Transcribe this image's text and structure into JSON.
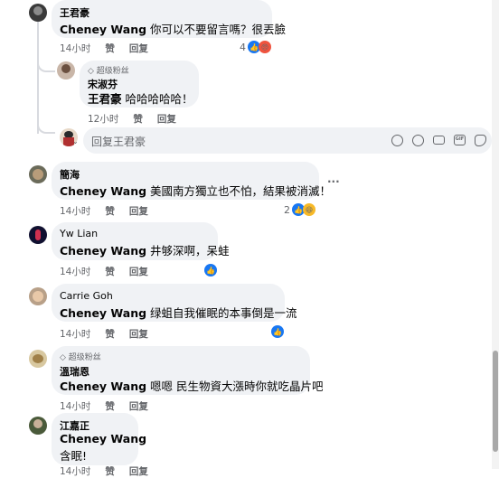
{
  "top_comment": {
    "author": "王君豪",
    "mention": "Cheney Wang",
    "text": "你可以不要留言嗎？很丟臉",
    "time": "14小时",
    "like": "赞",
    "reply": "回复",
    "reaction_count": "4"
  },
  "reply": {
    "badge": "超级粉丝",
    "author": "宋淑芬",
    "mention": "王君豪",
    "text": "哈哈哈哈哈！",
    "time": "12小时",
    "like": "赞",
    "reply": "回复"
  },
  "reply_box": {
    "placeholder": "回复王君豪"
  },
  "comments": [
    {
      "author": "簡海",
      "mention": "Cheney Wang",
      "text": "美國南方獨立也不怕，結果被消滅！",
      "time": "14小时",
      "like": "赞",
      "reply": "回复",
      "reaction_count": "2",
      "more": "···"
    },
    {
      "author": "Yw Lian",
      "mention": "Cheney Wang",
      "text": "井够深啊，呆蛙",
      "time": "14小时",
      "like": "赞",
      "reply": "回复"
    },
    {
      "author": "Carrie Goh",
      "mention": "Cheney Wang",
      "text": "绿蛆自我催眠的本事倒是一流",
      "time": "14小时",
      "like": "赞",
      "reply": "回复"
    },
    {
      "badge": "超级粉丝",
      "author": "溫瑞恩",
      "mention": "Cheney Wang",
      "text": "嗯嗯 民生物資大漲時你就吃晶片吧",
      "time": "14小时",
      "like": "赞",
      "reply": "回复"
    },
    {
      "author": "江嘉正",
      "mention": "Cheney Wang",
      "text": "含眠!",
      "time": "14小时",
      "like": "赞",
      "reply": "回复"
    }
  ],
  "colors": {
    "bubble": "#f0f2f5",
    "like_blue": "#1877f2",
    "meta_gray": "#65676b",
    "thread_line": "#d8dadf"
  }
}
